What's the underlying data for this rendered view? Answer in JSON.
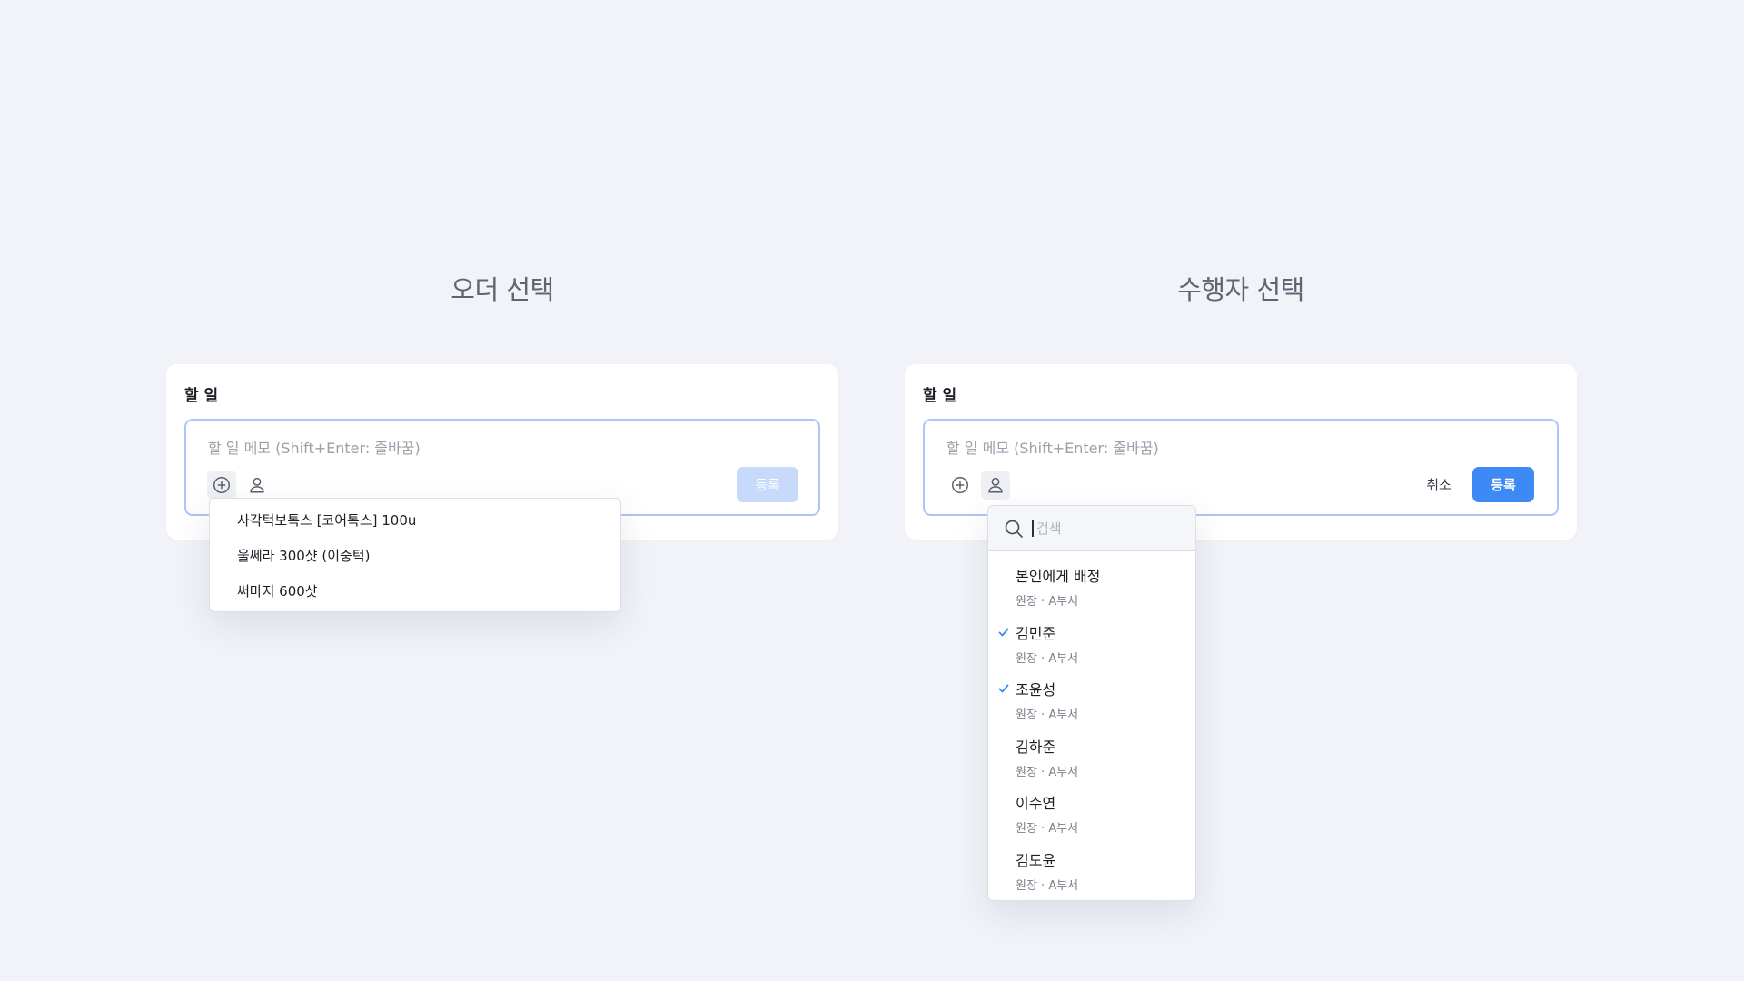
{
  "left_panel": {
    "section_title": "오더 선택",
    "card_title": "할 일",
    "placeholder": "할 일 메모 (Shift+Enter: 줄바꿈)",
    "submit_label": "등록",
    "order_options": [
      "사각턱보톡스 [코어톡스] 100u",
      "울쎄라 300샷 (이중턱)",
      "써마지 600샷"
    ]
  },
  "right_panel": {
    "section_title": "수행자 선택",
    "card_title": "할 일",
    "placeholder": "할 일 메모 (Shift+Enter: 줄바꿈)",
    "cancel_label": "취소",
    "submit_label": "등록",
    "search_placeholder": "검색",
    "assignees": [
      {
        "name": "본인에게 배정",
        "role": "원장 · A부서",
        "checked": false
      },
      {
        "name": "김민준",
        "role": "원장 · A부서",
        "checked": true
      },
      {
        "name": "조윤성",
        "role": "원장 · A부서",
        "checked": true
      },
      {
        "name": "김하준",
        "role": "원장 · A부서",
        "checked": false
      },
      {
        "name": "이수연",
        "role": "원장 · A부서",
        "checked": false
      },
      {
        "name": "김도윤",
        "role": "원장 · A부서",
        "checked": false
      }
    ]
  },
  "colors": {
    "accent": "#3d89f5",
    "accent_disabled": "#c7dafb",
    "editor_border": "#aac6fb",
    "background": "#f1f3f8"
  },
  "icons": {
    "add": "plus-circle-icon",
    "assignee": "user-icon",
    "search": "search-icon",
    "check": "check-icon"
  }
}
